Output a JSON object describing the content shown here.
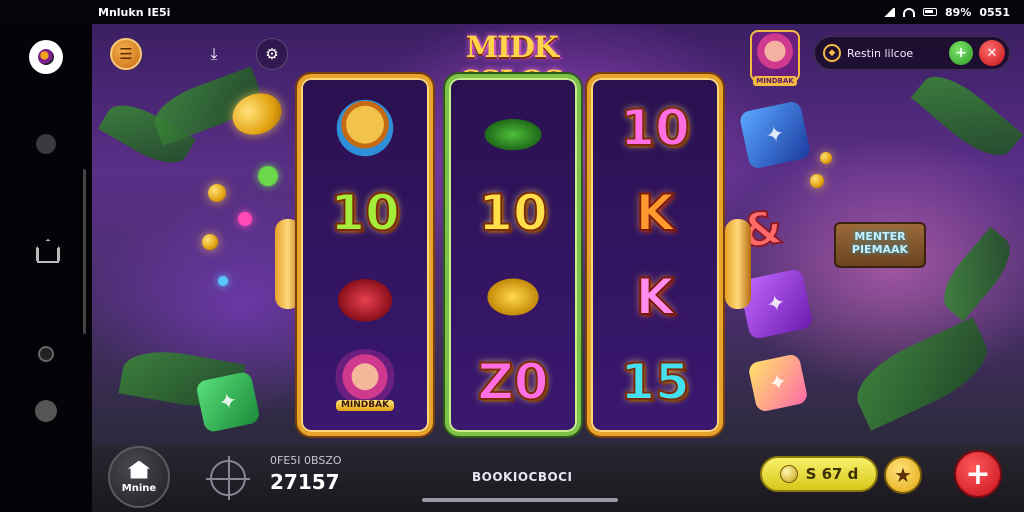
{
  "status_bar": {
    "left_text": "Mnlukn IE5i",
    "battery": "89%",
    "time": "0551"
  },
  "header": {
    "game_title": "MIDK SSLOS",
    "promo_text": "Restin lilcoe",
    "avatar_plate": "MINDBAK"
  },
  "icons": {
    "menu": "menu-icon",
    "download": "download-icon",
    "settings": "settings-icon",
    "promo_ring": "gem-ring-icon",
    "add": "plus-icon",
    "close": "close-icon",
    "home": "home-icon",
    "crosshair": "crosshair-icon",
    "star": "star-icon"
  },
  "reels": [
    {
      "symbols": [
        {
          "kind": "icon",
          "style": "face-a",
          "name": "golden-character-symbol"
        },
        {
          "kind": "num",
          "text": "10",
          "color": "green"
        },
        {
          "kind": "icon",
          "style": "amp-shield",
          "name": "ampersand-shield-symbol"
        },
        {
          "kind": "icon",
          "style": "girl",
          "name": "mindbak-character-symbol",
          "plate": "MINDBAK"
        }
      ]
    },
    {
      "symbols": [
        {
          "kind": "icon",
          "style": "croc",
          "name": "crocodile-symbol"
        },
        {
          "kind": "num",
          "text": "10",
          "color": "gold"
        },
        {
          "kind": "icon",
          "style": "gold-egg",
          "name": "golden-egg-symbol"
        },
        {
          "kind": "num",
          "text": "Z0",
          "color": "pink"
        }
      ]
    },
    {
      "symbols": [
        {
          "kind": "num",
          "text": "10",
          "color": "pink"
        },
        {
          "kind": "letter",
          "text": "K",
          "color": "orange"
        },
        {
          "kind": "letter",
          "text": "K",
          "color": "pink"
        },
        {
          "kind": "num",
          "text": "15",
          "color": "cyan"
        }
      ]
    }
  ],
  "scenery": {
    "sign_text": "MENTER PIEMAAK",
    "side_amp": "&"
  },
  "bottom_bar": {
    "home_label": "Mnine",
    "bet_label": "0FE5I 0BSZO",
    "bet_value": "27157",
    "title": "BOOKIOCBOCI",
    "balance": "S 67 d",
    "plus_symbol": "+"
  },
  "colors": {
    "gold_frame": "#e7a32a",
    "green_frame": "#7fc24a",
    "accent_red": "#c40f1a",
    "accent_yellow": "#f8f06a"
  }
}
